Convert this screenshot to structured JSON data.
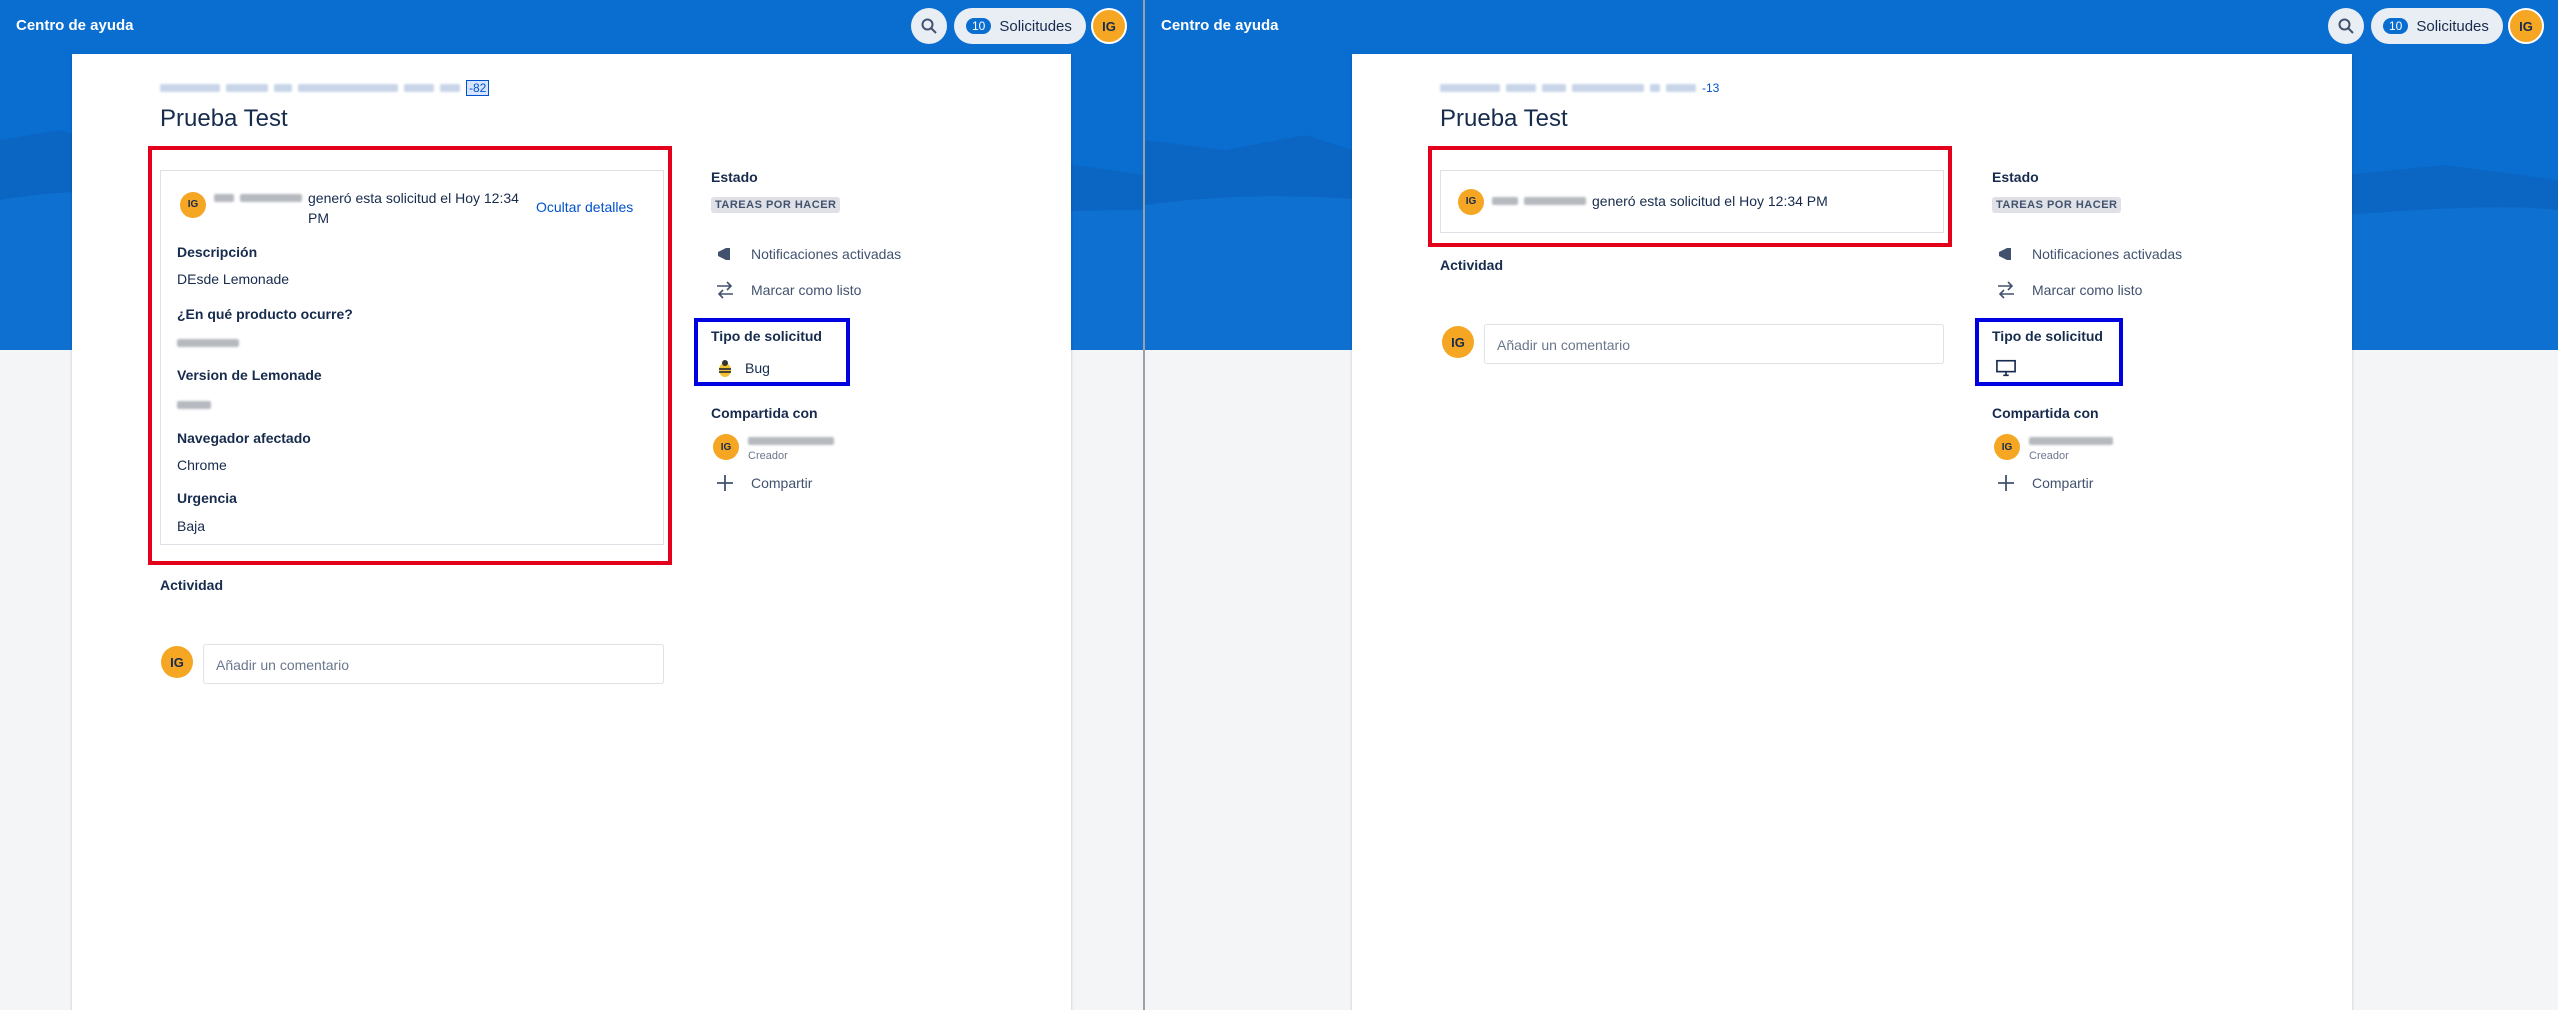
{
  "topbar": {
    "title": "Centro de ayuda",
    "requests_count": "10",
    "requests_label": "Solicitudes",
    "avatar_initials": "IG"
  },
  "left": {
    "issue_key": "-82",
    "title": "Prueba Test",
    "generated_text": "generó esta solicitud el Hoy 12:34",
    "generated_text_cont": "PM",
    "hide_details": "Ocultar detalles",
    "fields": [
      {
        "label": "Descripción",
        "value": "DEsde Lemonade"
      },
      {
        "label": "¿En qué producto ocurre?",
        "value": ""
      },
      {
        "label": "Version de Lemonade",
        "value": ""
      },
      {
        "label": "Navegador afectado",
        "value": "Chrome"
      },
      {
        "label": "Urgencia",
        "value": "Baja"
      }
    ],
    "activity_label": "Actividad",
    "comment_placeholder": "Añadir un comentario",
    "sidebar": {
      "status_label": "Estado",
      "status_value": "TAREAS POR HACER",
      "notifications": "Notificaciones activadas",
      "mark_done": "Marcar como listo",
      "request_type_label": "Tipo de solicitud",
      "request_type_value": "Bug",
      "shared_label": "Compartida con",
      "shared_role": "Creador",
      "share": "Compartir"
    }
  },
  "right": {
    "issue_key": "-13",
    "title": "Prueba Test",
    "generated_text": "generó esta solicitud el Hoy 12:34 PM",
    "activity_label": "Actividad",
    "comment_placeholder": "Añadir un comentario",
    "sidebar": {
      "status_label": "Estado",
      "status_value": "TAREAS POR HACER",
      "notifications": "Notificaciones activadas",
      "mark_done": "Marcar como listo",
      "request_type_label": "Tipo de solicitud",
      "shared_label": "Compartida con",
      "shared_role": "Creador",
      "share": "Compartir"
    }
  },
  "colors": {
    "brand_blue": "#0a6ed1",
    "highlight_red": "#e3001b",
    "highlight_blue": "#0000e0",
    "avatar_orange": "#f5a623"
  },
  "icons": [
    "search-icon",
    "megaphone-icon",
    "transition-icon",
    "bug-icon",
    "monitor-icon",
    "plus-icon"
  ]
}
